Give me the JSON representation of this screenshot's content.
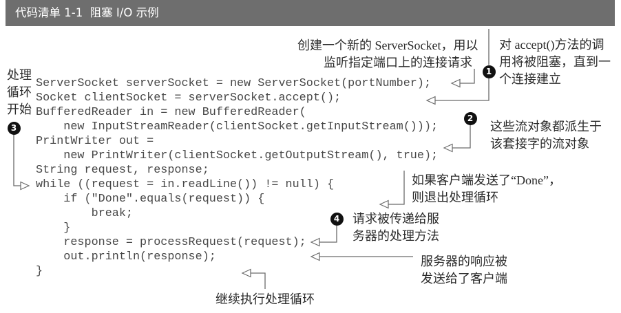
{
  "header": {
    "title": "代码清单 1-1  阻塞 I/O 示例"
  },
  "code": {
    "lines": [
      "ServerSocket serverSocket = new ServerSocket(portNumber);",
      "Socket clientSocket = serverSocket.accept();",
      "BufferedReader in = new BufferedReader(",
      "    new InputStreamReader(clientSocket.getInputStream()));",
      "PrintWriter out =",
      "    new PrintWriter(clientSocket.getOutputStream(), true);",
      "String request, response;",
      "while ((request = in.readLine()) != null) {",
      "    if (\"Done\".equals(request)) {",
      "        break;",
      "    }",
      "    response = processRequest(request);",
      "    out.println(response);",
      "}"
    ]
  },
  "annotations": {
    "create_server_socket": {
      "lines": [
        "创建一个新的 ServerSocket，用以",
        "监听指定端口上的连接请求"
      ]
    },
    "accept_blocks": {
      "marker": "1",
      "lines": [
        "对 accept()方法的调",
        "用将被阻塞，直到一",
        "个连接建立"
      ]
    },
    "streams_derived": {
      "marker": "2",
      "lines": [
        "这些流对象都派生于",
        "该套接字的流对象"
      ]
    },
    "loop_begins": {
      "marker": "3",
      "lines": [
        "处理",
        "循环",
        "开始"
      ]
    },
    "done_exits_loop": {
      "lines": [
        "如果客户端发送了“Done”，",
        "则退出处理循环"
      ]
    },
    "request_processed": {
      "marker": "4",
      "lines": [
        "请求被传递给服",
        "务器的处理方法"
      ]
    },
    "response_sent": {
      "lines": [
        "服务器的响应被",
        "发送给了客户端"
      ]
    },
    "loop_continues": {
      "lines": [
        "继续执行处理循环"
      ]
    }
  },
  "colors": {
    "header_background": "#6e6e6e",
    "header_text": "#ffffff",
    "code_text": "#474747",
    "annotation_text": "#2b2b2b",
    "callout_line": "#6a6a6a",
    "marker_background": "#111111",
    "marker_text": "#ffffff"
  }
}
